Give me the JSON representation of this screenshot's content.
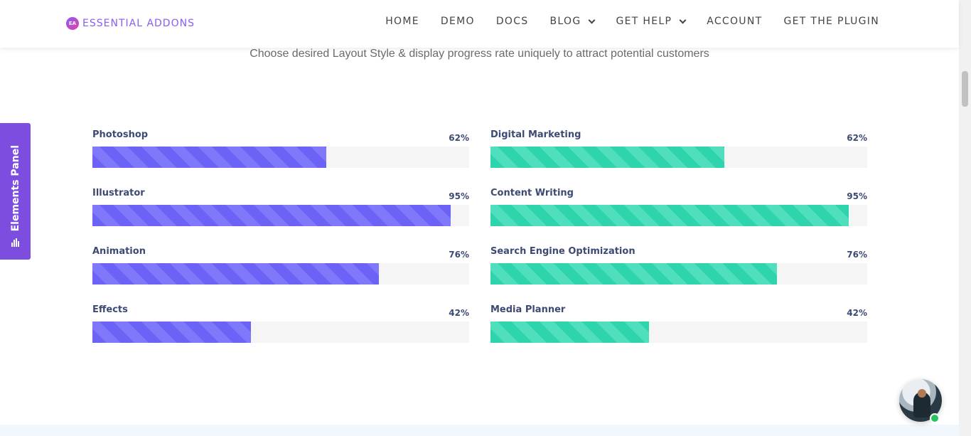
{
  "header": {
    "logo_mark": "EA",
    "logo_text": "ESSENTIAL ADDONS",
    "nav": [
      {
        "label": "HOME",
        "dropdown": false
      },
      {
        "label": "DEMO",
        "dropdown": false
      },
      {
        "label": "DOCS",
        "dropdown": false
      },
      {
        "label": "BLOG",
        "dropdown": true
      },
      {
        "label": "GET HELP",
        "dropdown": true
      },
      {
        "label": "ACCOUNT",
        "dropdown": false
      },
      {
        "label": "GET THE PLUGIN",
        "dropdown": false
      }
    ]
  },
  "subtitle": "Choose desired Layout Style & display progress rate uniquely to attract potential customers",
  "elements_panel": {
    "label": "Elements Panel",
    "icon": "bar-chart-icon",
    "color": "#7c4dde"
  },
  "progress": {
    "left": {
      "color": "#6c63f6",
      "items": [
        {
          "label": "Photoshop",
          "value_text": "62%",
          "value": 62
        },
        {
          "label": "Illustrator",
          "value_text": "95%",
          "value": 95
        },
        {
          "label": "Animation",
          "value_text": "76%",
          "value": 76
        },
        {
          "label": "Effects",
          "value_text": "42%",
          "value": 42
        }
      ]
    },
    "right": {
      "color": "#2dd4ac",
      "items": [
        {
          "label": "Digital Marketing",
          "value_text": "62%",
          "value": 62
        },
        {
          "label": "Content Writing",
          "value_text": "95%",
          "value": 95
        },
        {
          "label": "Search Engine Optimization",
          "value_text": "76%",
          "value": 76
        },
        {
          "label": "Media Planner",
          "value_text": "42%",
          "value": 42
        }
      ]
    }
  },
  "chat": {
    "icon": "chat-avatar-icon",
    "status": "online"
  }
}
